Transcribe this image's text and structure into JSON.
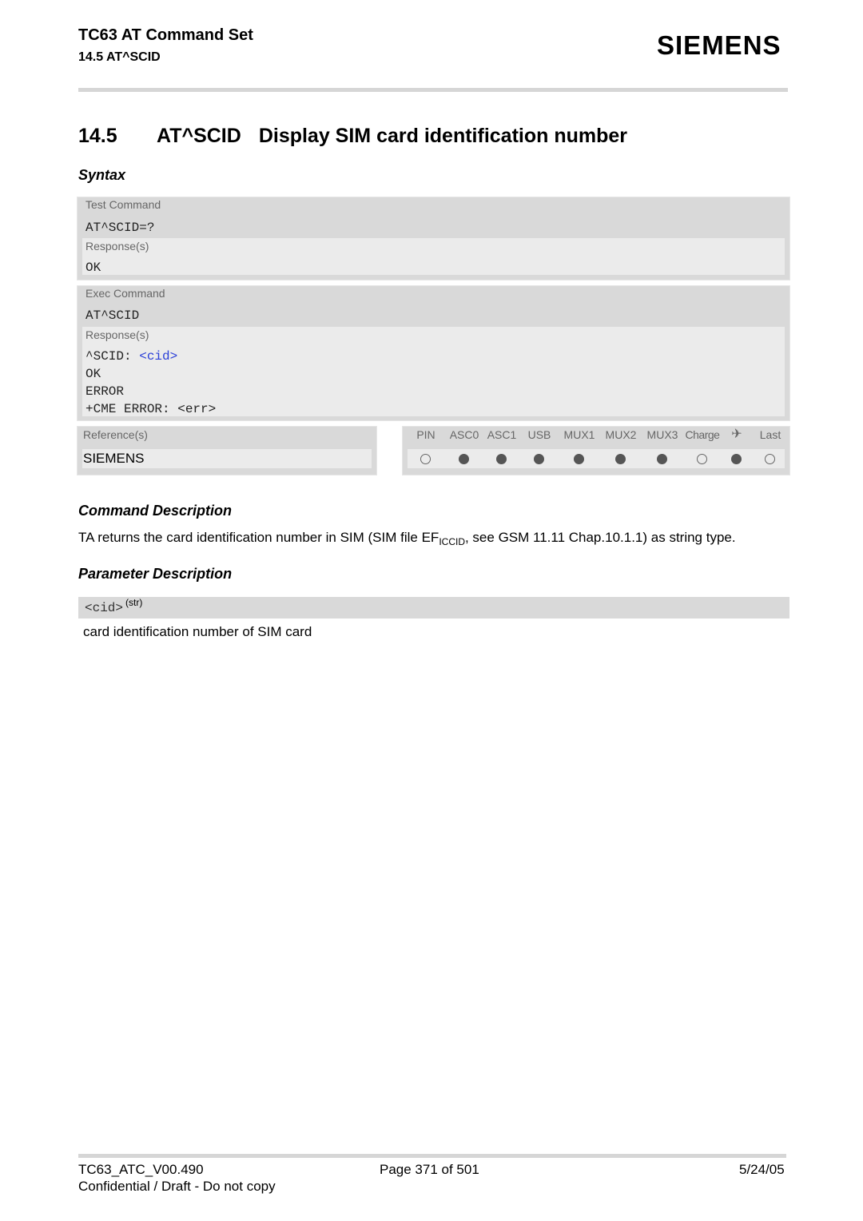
{
  "header": {
    "doc_title": "TC63 AT Command Set",
    "section_ref": "14.5 AT^SCID",
    "logo": "SIEMENS"
  },
  "section": {
    "number": "14.5",
    "command": "AT^SCID",
    "title": "Display SIM card identification number"
  },
  "syntax": {
    "heading": "Syntax",
    "test": {
      "label": "Test Command",
      "command": "AT^SCID=?",
      "responses_label": "Response(s)",
      "responses": [
        "OK"
      ]
    },
    "exec": {
      "label": "Exec Command",
      "command": "AT^SCID",
      "responses_label": "Response(s)",
      "response_prefix": "^SCID: ",
      "response_param": "<cid>",
      "responses": [
        "OK",
        "ERROR",
        "+CME ERROR: <err>"
      ]
    },
    "references": {
      "label": "Reference(s)",
      "value": "SIEMENS"
    },
    "availability": {
      "columns": [
        {
          "label": "PIN",
          "active": false
        },
        {
          "label": "ASC0",
          "active": true
        },
        {
          "label": "ASC1",
          "active": true
        },
        {
          "label": "USB",
          "active": true
        },
        {
          "label": "MUX1",
          "active": true
        },
        {
          "label": "MUX2",
          "active": true
        },
        {
          "label": "MUX3",
          "active": true
        },
        {
          "label": "Charge",
          "active": false
        },
        {
          "label": "✈",
          "icon": "airplane-icon",
          "active": true
        },
        {
          "label": "Last",
          "active": false
        }
      ]
    }
  },
  "command_description": {
    "heading": "Command Description",
    "text_before": "TA returns the card identification number in SIM (SIM file EF",
    "text_sub": "ICCID",
    "text_after": ", see GSM 11.11 Chap.10.1.1) as string type."
  },
  "parameter_description": {
    "heading": "Parameter Description",
    "param_name": "<cid>",
    "param_type": "(str)",
    "param_text": "card identification number of SIM card"
  },
  "footer": {
    "doc_id": "TC63_ATC_V00.490",
    "confidentiality": "Confidential / Draft - Do not copy",
    "page": "Page 371 of 501",
    "date": "5/24/05"
  }
}
